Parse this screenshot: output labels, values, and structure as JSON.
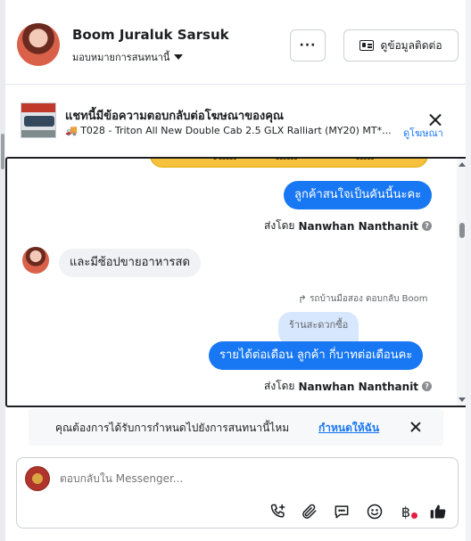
{
  "header": {
    "contact_name": "Boom Juraluk Sarsuk",
    "assign_label": "มอบหมายการสนทนานี้",
    "more_label": "···",
    "contact_info_label": "ดูข้อมูลติดต่อ"
  },
  "ad_banner": {
    "title": "แชทนี้มีข้อความตอบกลับต่อโฆษณาของคุณ",
    "subtitle": "T028 - Triton All New Double Cab 2.5 GLX Ralliart (MY20) MT*...",
    "view_ad_link": "ดูโฆษณา"
  },
  "chat": {
    "messages": [
      {
        "direction": "out",
        "text": "ลูกค้าสนใจเป็นคันนี้นะคะ"
      },
      {
        "sent_by_prefix": "ส่งโดย",
        "sent_by_name": "Nanwhan Nanthanit"
      },
      {
        "direction": "in",
        "text": "และมีซ้อปขายอาหารสด"
      },
      {
        "reply_note": "รถบ้านมือสอง ตอบกลับ Boom"
      },
      {
        "quoted_text": "ร้านสะดวกซื้อ"
      },
      {
        "direction": "out",
        "text": "รายได้ต่อเดือน  ลูกค้า กี่บาทต่อเดือนคะ"
      },
      {
        "sent_by_prefix": "ส่งโดย",
        "sent_by_name": "Nanwhan Nanthanit"
      }
    ]
  },
  "suggestion": {
    "text": "คุณต้องการได้รับการกำหนดไปยังการสนทนานี้ไหม",
    "link": "กำหนดให้ฉัน"
  },
  "composer": {
    "placeholder": "ตอบกลับใน Messenger...",
    "tools": [
      "phone-plus-icon",
      "paperclip-icon",
      "chat-bubble-icon",
      "emoji-icon",
      "baht-icon",
      "thumbs-up-icon"
    ],
    "baht_symbol": "฿"
  },
  "colors": {
    "accent": "#1877f2",
    "outgoing_bubble": "#1877f2",
    "incoming_bubble": "#f0f2f5",
    "notification_dot": "#e41e3f"
  }
}
